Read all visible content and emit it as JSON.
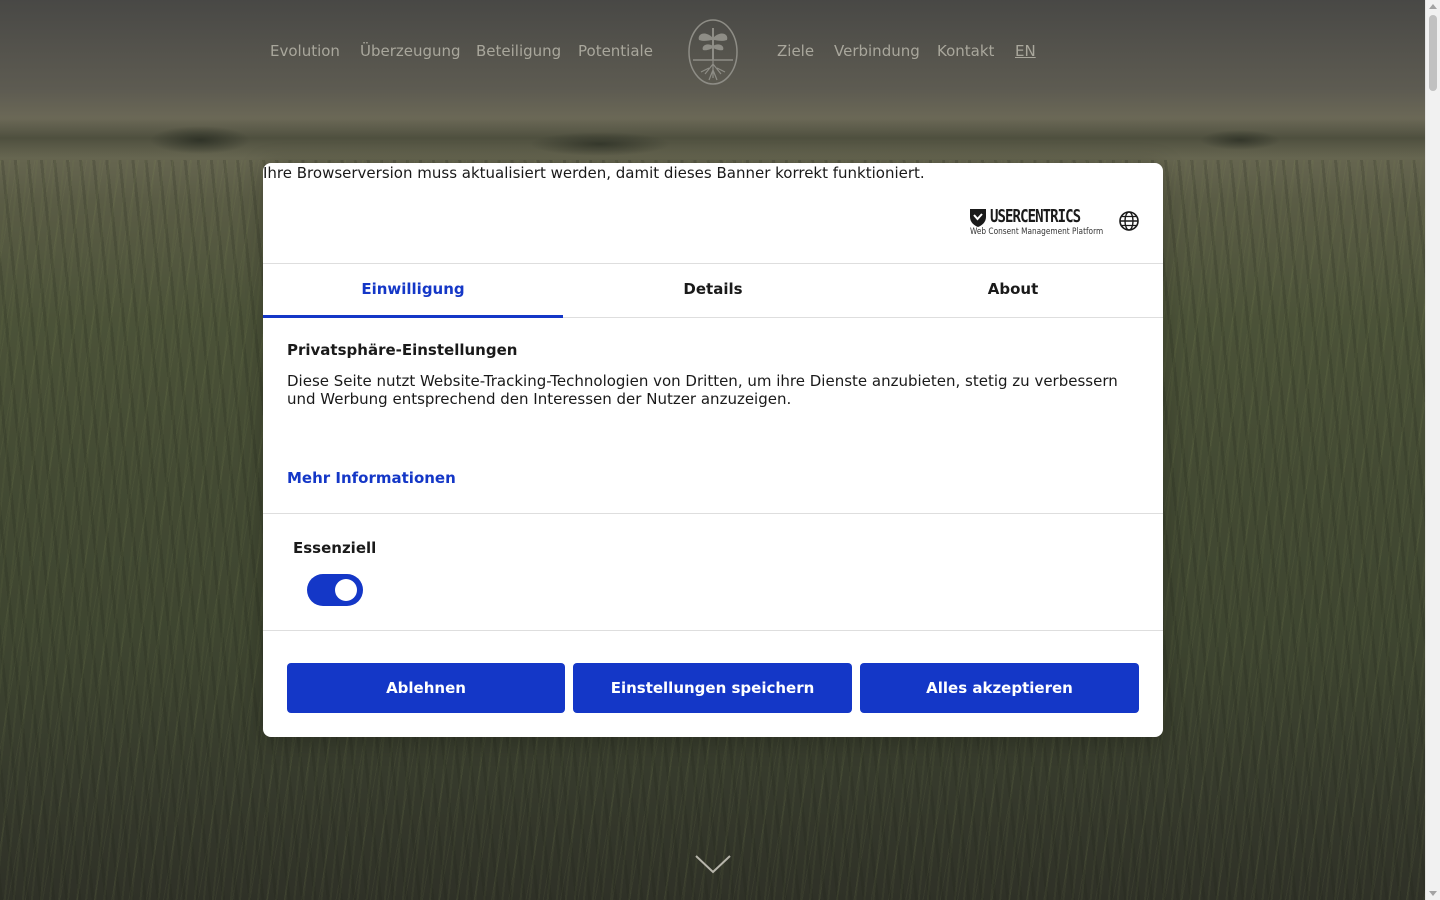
{
  "site": {
    "nav_left": [
      "Evolution",
      "Überzeugung",
      "Beteiligung",
      "Potentiale"
    ],
    "nav_right": [
      "Ziele",
      "Verbindung",
      "Kontakt"
    ],
    "language_link": "EN",
    "logo_icon": "plant-roots-emblem-icon",
    "scroll_icon": "chevron-down-icon"
  },
  "consent": {
    "browser_warning": "Ihre Browserversion muss aktualisiert werden, damit dieses Banner korrekt funktioniert.",
    "brand_name": "USERCENTRICS",
    "brand_tagline": "Web Consent Management Platform",
    "language_icon": "globe-icon",
    "tabs": [
      {
        "label": "Einwilligung",
        "active": true
      },
      {
        "label": "Details",
        "active": false
      },
      {
        "label": "About",
        "active": false
      }
    ],
    "title": "Privatsphäre-Einstellungen",
    "description": "Diese Seite nutzt Website-Tracking-Technologien von Dritten, um ihre Dienste anzubieten, stetig zu verbessern und Werbung entsprechend den Interessen der Nutzer anzuzeigen.",
    "more_info": "Mehr Informationen",
    "category": {
      "label": "Essenziell",
      "enabled": true
    },
    "buttons": {
      "deny": "Ablehnen",
      "save": "Einstellungen speichern",
      "accept_all": "Alles akzeptieren"
    },
    "accent_color": "#1437c7"
  }
}
